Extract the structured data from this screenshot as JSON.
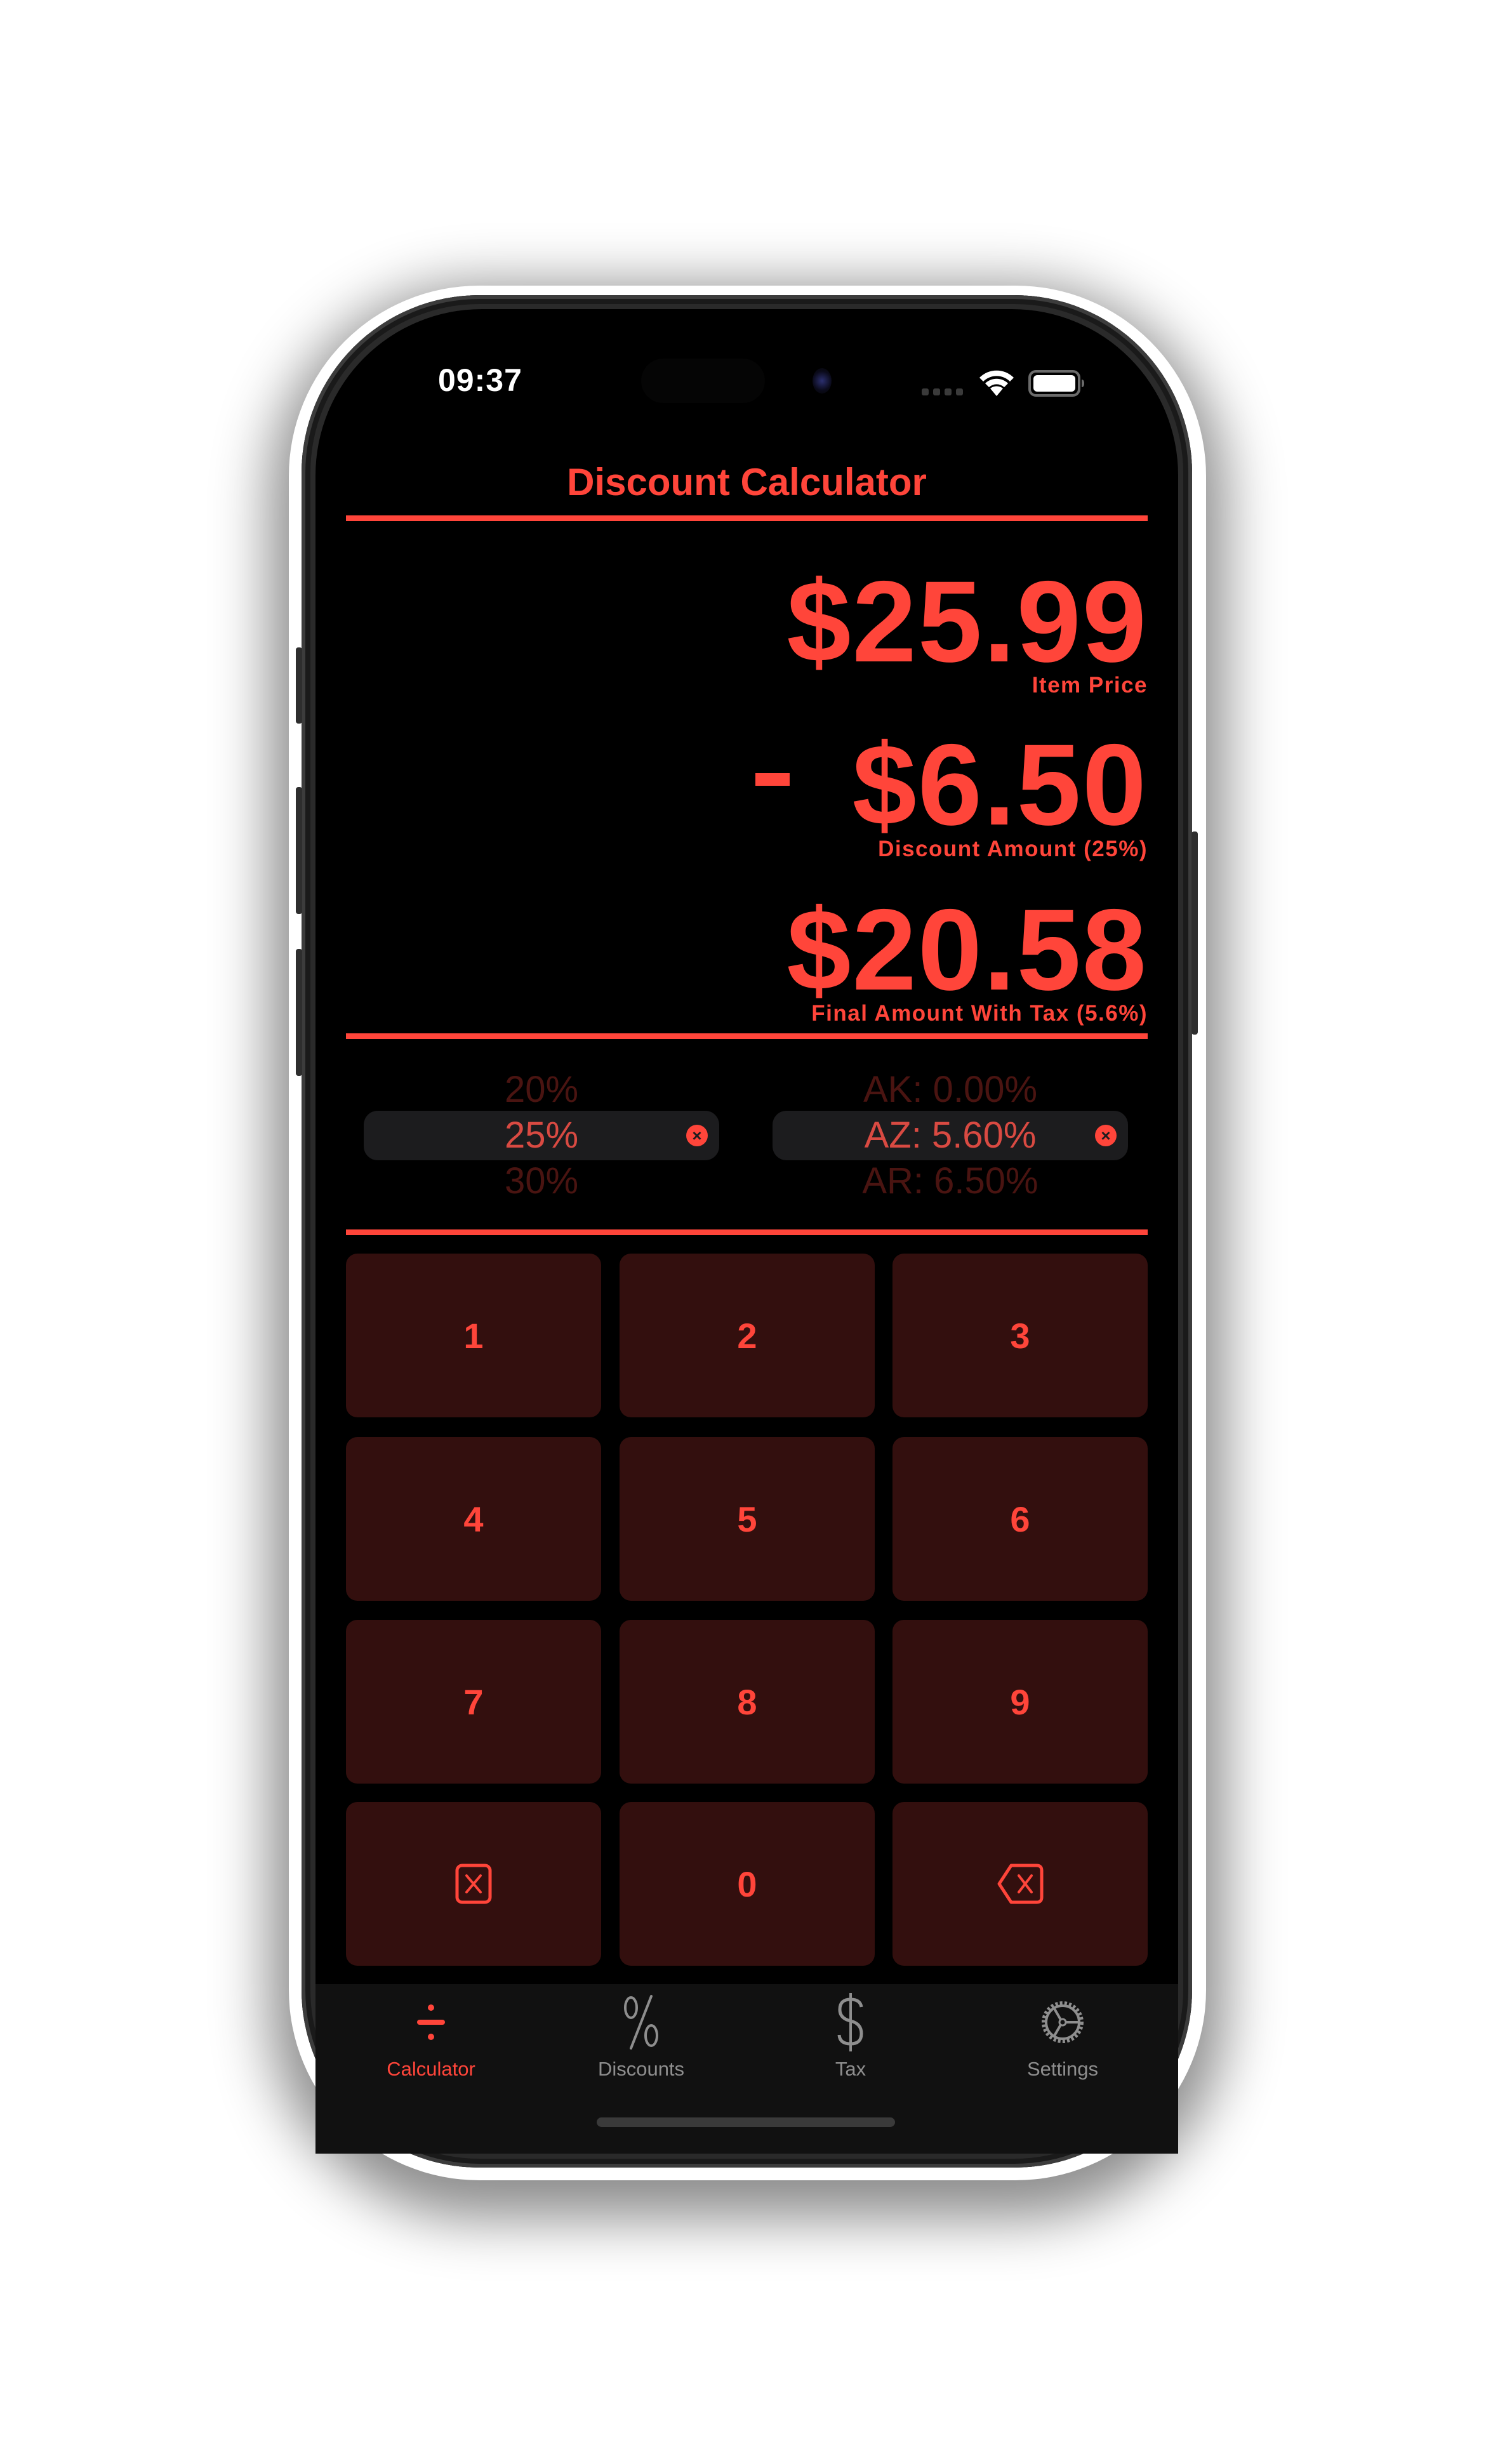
{
  "status_bar": {
    "time": "09:37"
  },
  "header": {
    "title": "Discount Calculator"
  },
  "display": {
    "item_price": "$25.99",
    "item_price_label": "Item Price",
    "discount_amount": "$6.50",
    "discount_sign": "-",
    "discount_label": "Discount Amount (25%)",
    "final_amount": "$20.58",
    "final_label": "Final Amount With Tax (5.6%)"
  },
  "discount_picker": {
    "above": "20%",
    "selected": "25%",
    "below": "30%",
    "clear_icon": "xmark-circle-icon"
  },
  "tax_picker": {
    "above": "AK: 0.00%",
    "selected": "AZ: 5.60%",
    "below": "AR: 6.50%",
    "clear_icon": "xmark-circle-icon"
  },
  "keypad": {
    "keys": [
      "1",
      "2",
      "3",
      "4",
      "5",
      "6",
      "7",
      "8",
      "9",
      "clear",
      "0",
      "backspace"
    ],
    "labels": {
      "k1": "1",
      "k2": "2",
      "k3": "3",
      "k4": "4",
      "k5": "5",
      "k6": "6",
      "k7": "7",
      "k8": "8",
      "k9": "9",
      "k0": "0"
    },
    "clear_icon": "clear-x-square-icon",
    "backspace_icon": "delete-left-icon"
  },
  "tabbar": {
    "items": [
      {
        "label": "Calculator",
        "icon": "divide-icon",
        "active": true
      },
      {
        "label": "Discounts",
        "icon": "percent-icon",
        "active": false
      },
      {
        "label": "Tax",
        "icon": "dollar-icon",
        "active": false
      },
      {
        "label": "Settings",
        "icon": "gear-icon",
        "active": false
      }
    ]
  },
  "colors": {
    "accent": "#ff453a",
    "key_background": "#330f0e",
    "screen_background": "#000000",
    "tabbar_background": "#111111",
    "inactive_tab": "#8e8e8e"
  }
}
